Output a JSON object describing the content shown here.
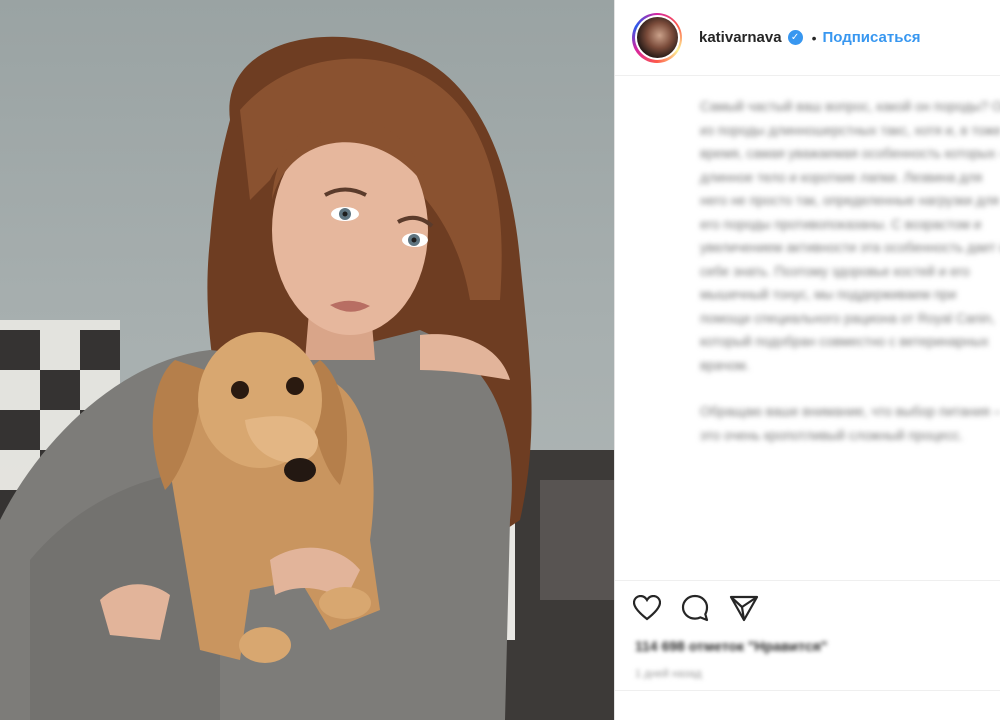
{
  "post": {
    "username": "kativarnava",
    "verified_glyph": "✓",
    "separator": "•",
    "follow_label": "Подписаться",
    "caption_paragraphs": [
      "Самый частый ваш вопрос, какой он породы? Он из породы длинношерстных такс, хотя и, в тоже время, самая уважаемая особенность которых – длинное тело и короткие лапки. Лезвина для него не просто так, определенные нагрузки для его породы противопоказаны. С возрастом и увеличением активности эта особенность дает о себе знать. Поэтому здоровье костей и его мышечный тонус, мы поддерживаем при помощи специального рациона от Royal Canin, который подобран совместно с ветеринарных врачом.",
      "Обращаю ваше внимание, что выбор питания – это очень кропотливый сложный процесс."
    ],
    "likes_text": "114 698 отметок \"Нравится\"",
    "time_text": "1 дней назад"
  },
  "icons": {
    "like": "heart-icon",
    "comment": "comment-icon",
    "share": "share-icon"
  },
  "colors": {
    "accent": "#3897f0",
    "text": "#262626",
    "divider": "#efefef"
  }
}
